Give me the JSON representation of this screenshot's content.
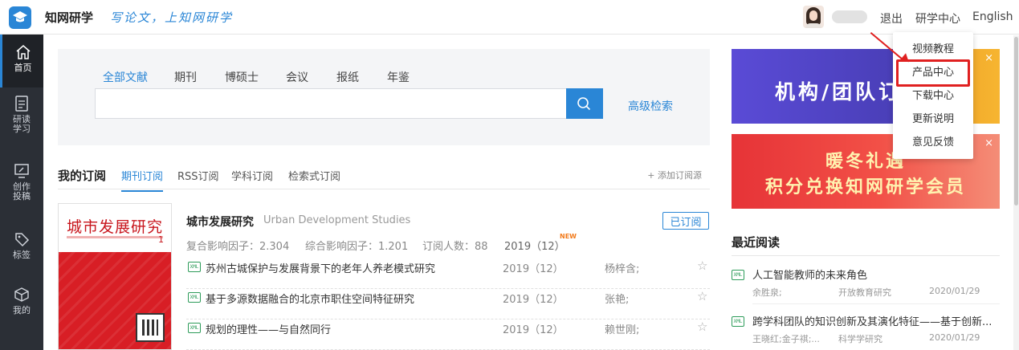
{
  "header": {
    "logo_text": "知网研学",
    "slogan": "写论文，上知网研学",
    "logout": "退出",
    "study_center": "研学中心",
    "language": "English"
  },
  "sidebar": {
    "items": [
      {
        "label": "首页",
        "icon": "home-icon"
      },
      {
        "label": "研读\n学习",
        "icon": "document-icon"
      },
      {
        "label": "创作\n投稿",
        "icon": "monitor-edit-icon"
      },
      {
        "label": "标签",
        "icon": "tag-icon"
      },
      {
        "label": "我的",
        "icon": "cube-icon"
      }
    ]
  },
  "search": {
    "tabs": [
      "全部文献",
      "期刊",
      "博硕士",
      "会议",
      "报纸",
      "年鉴"
    ],
    "active_tab": "全部文献",
    "value": "",
    "advanced": "高级检索"
  },
  "subscription": {
    "title": "我的订阅",
    "tabs": [
      "期刊订阅",
      "RSS订阅",
      "学科订阅",
      "检索式订阅"
    ],
    "add_source": "+ 添加订阅源",
    "journal": {
      "cover_title": "城市发展研究",
      "cover_issue": "1",
      "name": "城市发展研究",
      "english_name": "Urban Development Studies",
      "subscribed": "已订阅",
      "composite_if": "复合影响因子：2.304",
      "comprehensive_if": "综合影响因子：1.201",
      "subscribers": "订阅人数：88",
      "latest_issue": "2019（12）",
      "new_badge": "NEW"
    },
    "articles": [
      {
        "title": "苏州古城保护与发展背景下的老年人养老模式研究",
        "issue": "2019（12）",
        "author": "杨梓含;"
      },
      {
        "title": "基于多源数据融合的北京市职住空间特征研究",
        "issue": "2019（12）",
        "author": "张艳;"
      },
      {
        "title": "规划的理性——与自然同行",
        "issue": "2019（12）",
        "author": "赖世刚;"
      }
    ]
  },
  "banners": {
    "banner1_text": "机构/团队订",
    "banner2_line1": "暖冬礼遇",
    "banner2_line2": "积分兑换知网研学会员",
    "close": "×"
  },
  "recent": {
    "title": "最近阅读",
    "items": [
      {
        "title": "人工智能教师的未来角色",
        "author": "余胜泉;",
        "source": "开放教育研究",
        "date": "2020/01/29"
      },
      {
        "title": "跨学科团队的知识创新及其演化特征——基于创新...",
        "author": "王晓红;金子祺;...",
        "source": "科学学研究",
        "date": "2020/01/29"
      }
    ]
  },
  "dropdown": {
    "items": [
      "视频教程",
      "产品中心",
      "下载中心",
      "更新说明",
      "意见反馈"
    ],
    "highlighted": "产品中心"
  },
  "colors": {
    "accent": "#2a86d6",
    "sidebar_bg": "#2b2f36",
    "highlight_red": "#e02020"
  }
}
